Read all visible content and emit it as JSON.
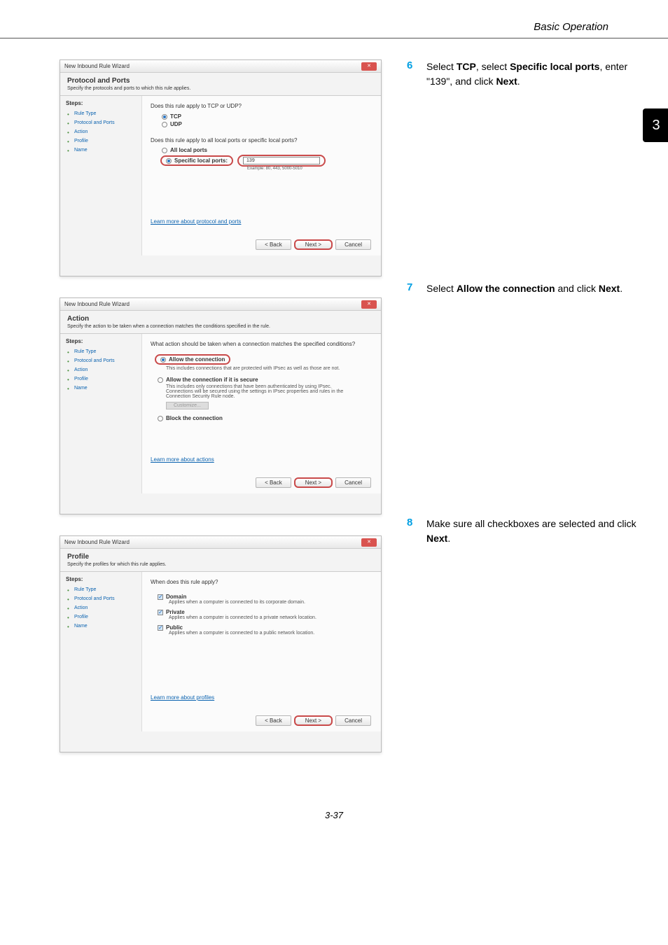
{
  "header": {
    "title": "Basic Operation"
  },
  "chapter_badge": "3",
  "footer": {
    "page": "3-37"
  },
  "wizard_common": {
    "window_title": "New Inbound Rule Wizard",
    "steps_label": "Steps:",
    "steps": [
      "Rule Type",
      "Protocol and Ports",
      "Action",
      "Profile",
      "Name"
    ],
    "back": "< Back",
    "next": "Next >",
    "cancel": "Cancel"
  },
  "wiz1": {
    "head": "Protocol and Ports",
    "sub": "Specify the protocols and ports to which this rule applies.",
    "q1": "Does this rule apply to TCP or UDP?",
    "tcp": "TCP",
    "udp": "UDP",
    "q2": "Does this rule apply to all local ports or specific local ports?",
    "allports": "All local ports",
    "specports": "Specific local ports:",
    "port_value": "139",
    "port_hint": "Example: 80, 443, 5000-5010",
    "learn": "Learn more about protocol and ports"
  },
  "wiz2": {
    "head": "Action",
    "sub": "Specify the action to be taken when a connection matches the conditions specified in the rule.",
    "q": "What action should be taken when a connection matches the specified conditions?",
    "allow": "Allow the connection",
    "allow_desc": "This includes connections that are protected with IPsec as well as those are not.",
    "allow_secure": "Allow the connection if it is secure",
    "allow_secure_desc": "This includes only connections that have been authenticated by using IPsec. Connections will be secured using the settings in IPsec properties and rules in the Connection Security Rule node.",
    "customize": "Customize...",
    "block": "Block the connection",
    "learn": "Learn more about actions"
  },
  "wiz3": {
    "head": "Profile",
    "sub": "Specify the profiles for which this rule applies.",
    "q": "When does this rule apply?",
    "domain": "Domain",
    "domain_desc": "Applies when a computer is connected to its corporate domain.",
    "private": "Private",
    "private_desc": "Applies when a computer is connected to a private network location.",
    "public": "Public",
    "public_desc": "Applies when a computer is connected to a public network location.",
    "learn": "Learn more about profiles"
  },
  "instructions": {
    "s6_num": "6",
    "s6_pre": "Select ",
    "s6_b1": "TCP",
    "s6_mid1": ", select ",
    "s6_b2": "Specific local ports",
    "s6_mid2": ", enter \"139\", and click ",
    "s6_b3": "Next",
    "s6_end": ".",
    "s7_num": "7",
    "s7_pre": "Select ",
    "s7_b1": "Allow the connection",
    "s7_mid": " and click ",
    "s7_b2": "Next",
    "s7_end": ".",
    "s8_num": "8",
    "s8_pre": "Make sure all checkboxes are selected and click ",
    "s8_b1": "Next",
    "s8_end": "."
  }
}
